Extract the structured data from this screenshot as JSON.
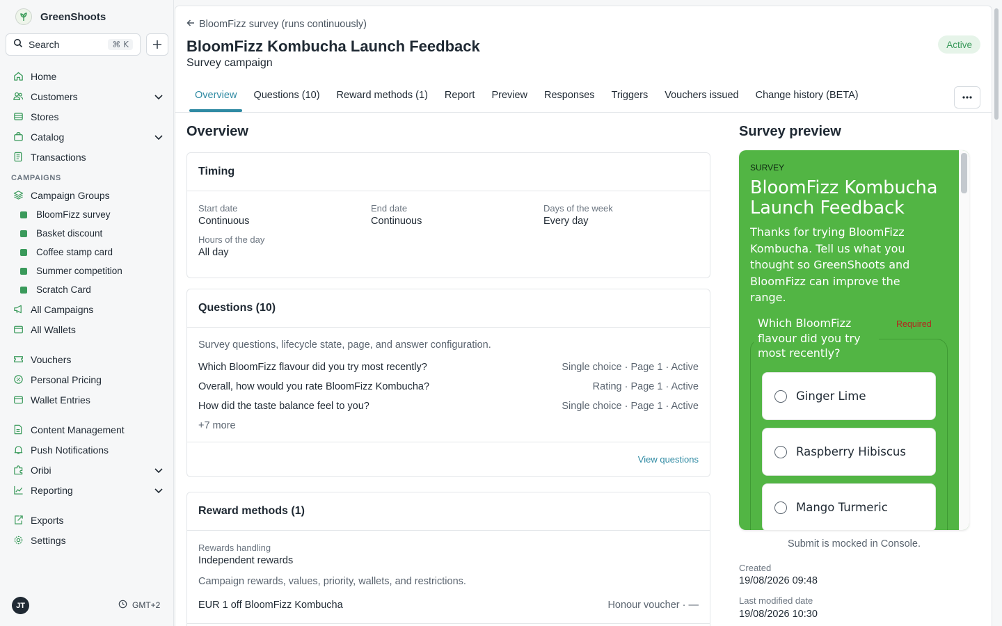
{
  "app": {
    "name": "GreenShoots"
  },
  "search": {
    "label": "Search",
    "shortcut": "⌘ K"
  },
  "nav": {
    "items_top": [
      {
        "label": "Home",
        "icon": "home-icon"
      },
      {
        "label": "Customers",
        "icon": "users-icon",
        "expandable": true
      },
      {
        "label": "Stores",
        "icon": "store-icon"
      },
      {
        "label": "Catalog",
        "icon": "bag-icon",
        "expandable": true
      },
      {
        "label": "Transactions",
        "icon": "receipt-icon"
      }
    ],
    "campaigns_section": "CAMPAIGNS",
    "campaign_groups": "Campaign Groups",
    "campaign_children": [
      "BloomFizz survey",
      "Basket discount",
      "Coffee stamp card",
      "Summer competition",
      "Scratch Card"
    ],
    "all_campaigns": "All Campaigns",
    "all_wallets": "All Wallets",
    "vouchers": "Vouchers",
    "personal_pricing": "Personal Pricing",
    "wallet_entries": "Wallet Entries",
    "content_management": "Content Management",
    "push_notifications": "Push Notifications",
    "oribi": "Oribi",
    "reporting": "Reporting",
    "exports": "Exports",
    "settings": "Settings"
  },
  "user": {
    "initials": "JT",
    "timezone": "GMT+2"
  },
  "header": {
    "back_label": "BloomFizz survey (runs continuously)",
    "title": "BloomFizz Kombucha Launch Feedback",
    "subtitle": "Survey campaign",
    "status": "Active"
  },
  "tabs": [
    "Overview",
    "Questions (10)",
    "Reward methods (1)",
    "Report",
    "Preview",
    "Responses",
    "Triggers",
    "Vouchers issued",
    "Change history (BETA)"
  ],
  "overview": {
    "title": "Overview",
    "timing": {
      "title": "Timing",
      "start_label": "Start date",
      "start_value": "Continuous",
      "end_label": "End date",
      "end_value": "Continuous",
      "days_label": "Days of the week",
      "days_value": "Every day",
      "hours_label": "Hours of the day",
      "hours_value": "All day"
    },
    "questions": {
      "title": "Questions (10)",
      "description": "Survey questions, lifecycle state, page, and answer configuration.",
      "rows": [
        {
          "text": "Which BloomFizz flavour did you try most recently?",
          "meta": "Single choice · Page 1 · Active"
        },
        {
          "text": "Overall, how would you rate BloomFizz Kombucha?",
          "meta": "Rating · Page 1 · Active"
        },
        {
          "text": "How did the taste balance feel to you?",
          "meta": "Single choice · Page 1 · Active"
        }
      ],
      "more": "+7 more",
      "link": "View questions"
    },
    "rewards": {
      "title": "Reward methods (1)",
      "handling_label": "Rewards handling",
      "handling_value": "Independent rewards",
      "description": "Campaign rewards, values, priority, wallets, and restrictions.",
      "row_text": "EUR 1 off BloomFizz Kombucha",
      "row_meta": "Honour voucher · —"
    }
  },
  "preview": {
    "title": "Survey preview",
    "eyebrow": "SURVEY",
    "survey_title": "BloomFizz Kombucha Launch Feedback",
    "description": "Thanks for trying BloomFizz Kombucha. Tell us what you thought so GreenShoots and BloomFizz can improve the range.",
    "question": "Which BloomFizz flavour did you try most recently?",
    "required": "Required",
    "options": [
      "Ginger Lime",
      "Raspberry Hibiscus",
      "Mango Turmeric"
    ],
    "note": "Submit is mocked in Console.",
    "created_label": "Created",
    "created_value": "19/08/2026 09:48",
    "modified_label": "Last modified date",
    "modified_value": "19/08/2026 10:30"
  },
  "colors": {
    "accent": "#2f8aa3",
    "brand_green": "#52b544",
    "status_green": "#3a9a5b",
    "required_red": "#b3261e"
  }
}
